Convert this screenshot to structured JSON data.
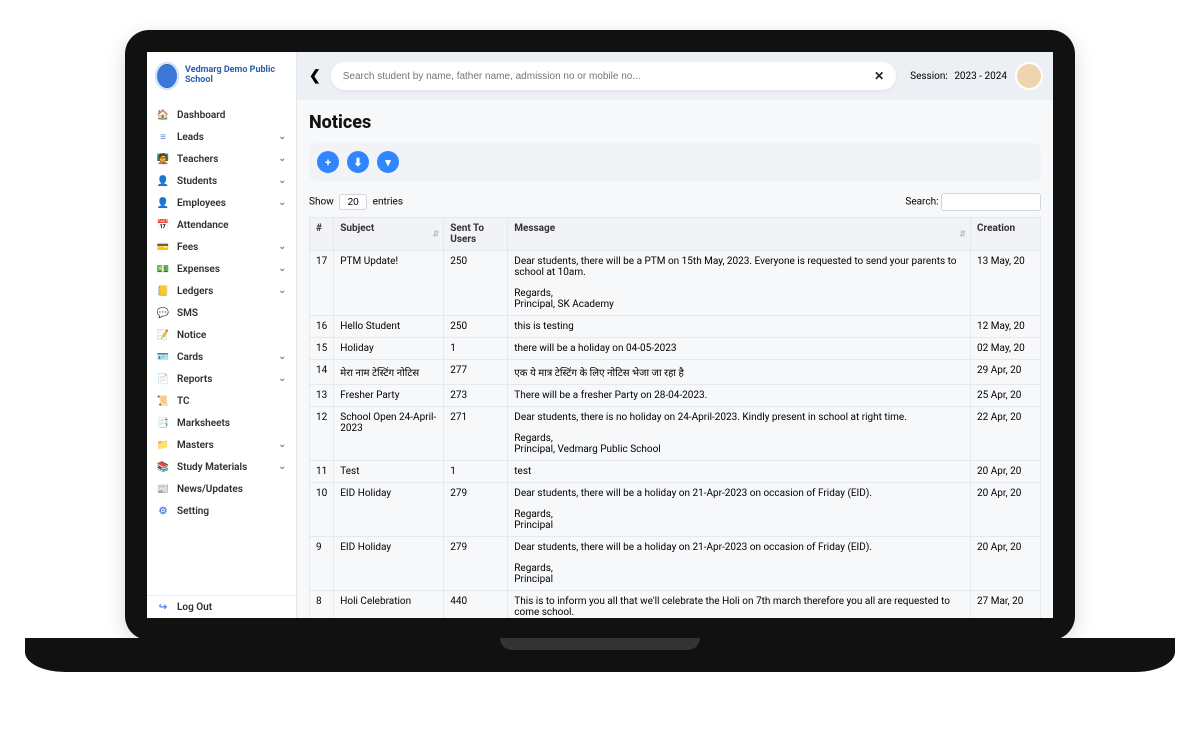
{
  "brand": {
    "name": "Vedmarg Demo Public School"
  },
  "sidebar": {
    "items": [
      {
        "label": "Dashboard",
        "icon": "home",
        "expandable": false
      },
      {
        "label": "Leads",
        "icon": "bars",
        "expandable": true
      },
      {
        "label": "Teachers",
        "icon": "presentation",
        "expandable": true
      },
      {
        "label": "Students",
        "icon": "person",
        "expandable": true
      },
      {
        "label": "Employees",
        "icon": "person",
        "expandable": true
      },
      {
        "label": "Attendance",
        "icon": "calendar",
        "expandable": false
      },
      {
        "label": "Fees",
        "icon": "wallet",
        "expandable": true
      },
      {
        "label": "Expenses",
        "icon": "money",
        "expandable": true
      },
      {
        "label": "Ledgers",
        "icon": "book",
        "expandable": true
      },
      {
        "label": "SMS",
        "icon": "chat",
        "expandable": false
      },
      {
        "label": "Notice",
        "icon": "note",
        "expandable": false
      },
      {
        "label": "Cards",
        "icon": "idcard",
        "expandable": true
      },
      {
        "label": "Reports",
        "icon": "report",
        "expandable": true
      },
      {
        "label": "TC",
        "icon": "cert",
        "expandable": false
      },
      {
        "label": "Marksheets",
        "icon": "sheet",
        "expandable": false
      },
      {
        "label": "Masters",
        "icon": "folder",
        "expandable": true
      },
      {
        "label": "Study Materials",
        "icon": "books",
        "expandable": true
      },
      {
        "label": "News/Updates",
        "icon": "news",
        "expandable": false
      },
      {
        "label": "Setting",
        "icon": "gear",
        "expandable": false
      }
    ],
    "logout": {
      "label": "Log Out",
      "icon": "logout"
    }
  },
  "topbar": {
    "search_placeholder": "Search student by name, father name, admission no or mobile no...",
    "session_label": "Session:",
    "session_value": "2023 - 2024"
  },
  "page": {
    "title": "Notices",
    "show_label": "Show",
    "entries_label": "entries",
    "entries_value": "20",
    "search_label": "Search:"
  },
  "table": {
    "headers": [
      "#",
      "Subject",
      "Sent To Users",
      "Message",
      "Creation"
    ],
    "rows": [
      {
        "idx": "17",
        "subject": "PTM Update!",
        "sent": "250",
        "message": "Dear students, there will be a PTM on 15th May, 2023. Everyone is requested to send your parents to school at 10am.\n\nRegards,\nPrincipal, SK Academy",
        "date": "13 May, 20"
      },
      {
        "idx": "16",
        "subject": "Hello Student",
        "sent": "250",
        "message": "this is testing",
        "date": "12 May, 20"
      },
      {
        "idx": "15",
        "subject": "Holiday",
        "sent": "1",
        "message": "there will be a holiday on 04-05-2023",
        "date": "02 May, 20"
      },
      {
        "idx": "14",
        "subject": "मेरा नाम टेस्टिंग नोटिस",
        "sent": "277",
        "message": "एक ये मात्र टेस्टिंग के लिए नोटिस भेजा जा रहा है",
        "date": "29 Apr, 20"
      },
      {
        "idx": "13",
        "subject": "Fresher Party",
        "sent": "273",
        "message": "There will be a fresher Party on 28-04-2023.",
        "date": "25 Apr, 20"
      },
      {
        "idx": "12",
        "subject": "School Open 24-April-2023",
        "sent": "271",
        "message": "Dear students, there is no holiday on 24-April-2023. Kindly present in school at right time.\n\nRegards,\nPrincipal, Vedmarg Public School",
        "date": "22 Apr, 20"
      },
      {
        "idx": "11",
        "subject": "Test",
        "sent": "1",
        "message": "test",
        "date": "20 Apr, 20"
      },
      {
        "idx": "10",
        "subject": "EID Holiday",
        "sent": "279",
        "message": "Dear students, there will be a holiday on 21-Apr-2023 on occasion of Friday (EID).\n\nRegards,\nPrincipal",
        "date": "20 Apr, 20"
      },
      {
        "idx": "9",
        "subject": "EID Holiday",
        "sent": "279",
        "message": "Dear students, there will be a holiday on 21-Apr-2023 on occasion of Friday (EID).\n\nRegards,\nPrincipal",
        "date": "20 Apr, 20"
      },
      {
        "idx": "8",
        "subject": "Holi Celebration",
        "sent": "440",
        "message": "This is to inform you all that we'll celebrate the Holi on 7th march therefore you all are requested to come school.",
        "date": "27 Mar, 20"
      }
    ]
  },
  "icons": {
    "home": "🏠",
    "bars": "≡",
    "presentation": "🧑‍🏫",
    "person": "👤",
    "calendar": "📅",
    "wallet": "💳",
    "money": "💵",
    "book": "📒",
    "chat": "💬",
    "note": "📝",
    "idcard": "🪪",
    "report": "📄",
    "cert": "📜",
    "sheet": "📑",
    "folder": "📁",
    "books": "📚",
    "news": "📰",
    "gear": "⚙",
    "logout": "↪"
  }
}
